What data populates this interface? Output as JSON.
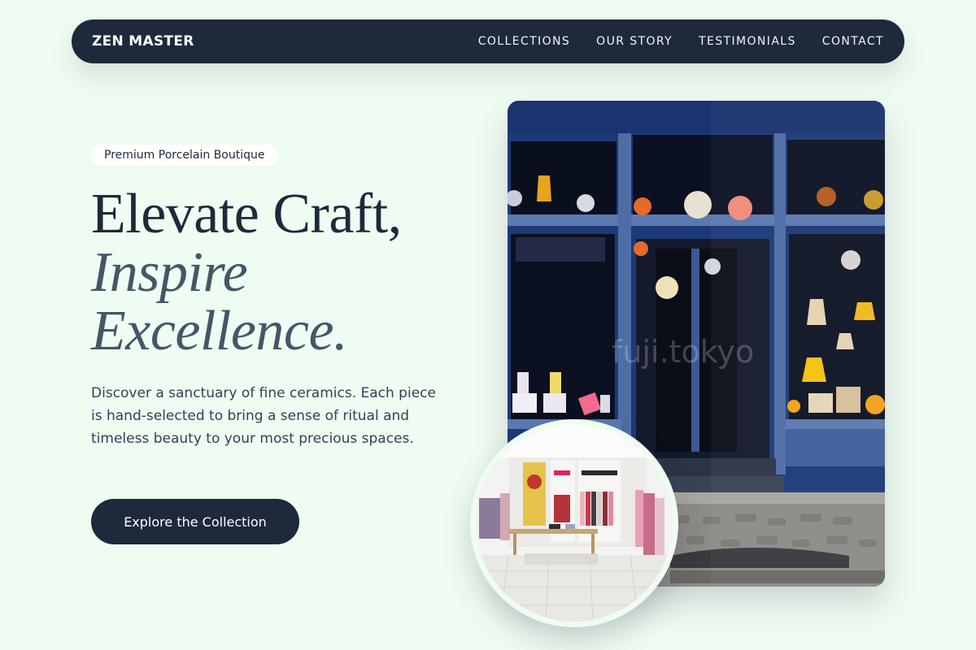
{
  "brand": "ZEN MASTER",
  "nav": {
    "links": [
      "COLLECTIONS",
      "OUR STORY",
      "TESTIMONIALS",
      "CONTACT"
    ]
  },
  "hero": {
    "badge": "Premium Porcelain Boutique",
    "headline_line1": "Elevate Craft,",
    "headline_line2": "Inspire",
    "headline_line3": "Excellence.",
    "lead": "Discover a sanctuary of fine ceramics. Each piece is hand-selected to bring a sense of ritual and timeless beauty to your most precious spaces.",
    "cta_label": "Explore the Collection"
  },
  "storefront": {
    "watermark": "fuji.tokyo"
  },
  "colors": {
    "background": "#effcf1",
    "navy": "#1e293b",
    "slate": "#475569"
  }
}
